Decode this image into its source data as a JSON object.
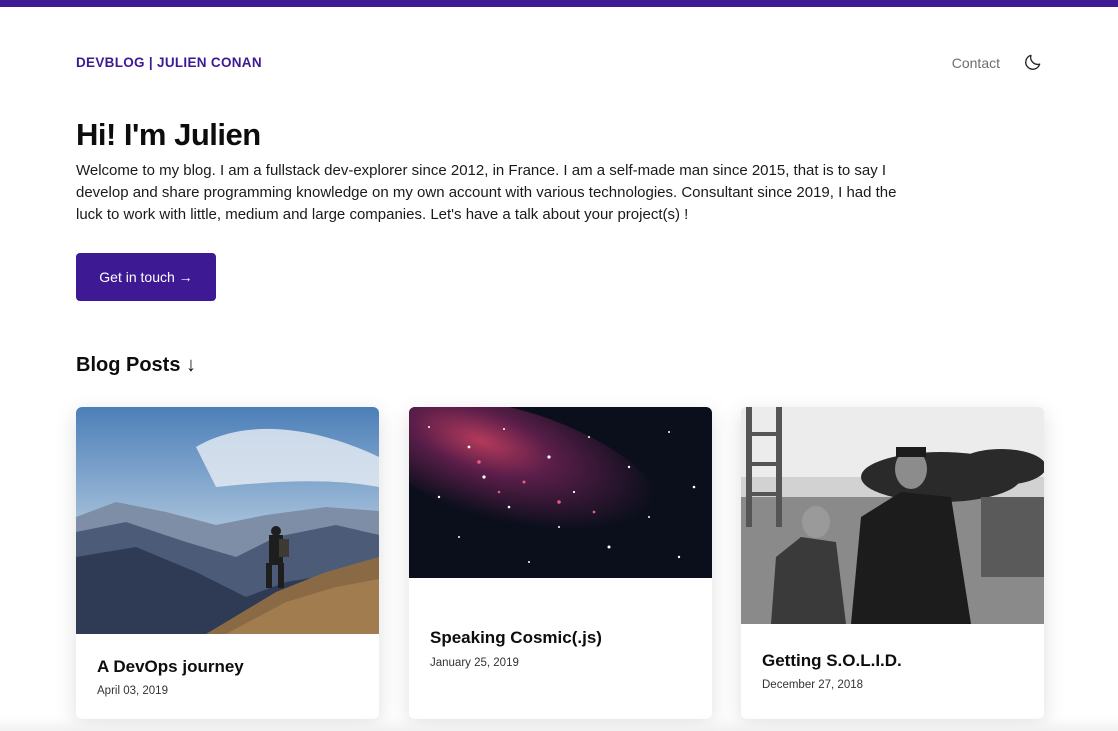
{
  "header": {
    "brand": "DEVBLOG | JULIEN CONAN",
    "nav": {
      "contact": "Contact"
    },
    "theme_icon": "moon-icon"
  },
  "hero": {
    "title": "Hi! I'm Julien",
    "text": "Welcome to my blog. I am a fullstack dev-explorer since 2012, in France. I am a self-made man since 2015, that is to say I develop and share programming knowledge on my own account with various technologies. Consultant since 2019, I had the luck to work with little, medium and large companies. Let's have a talk about your project(s) !",
    "cta": "Get in touch →"
  },
  "blog": {
    "section_title": "Blog Posts ↓",
    "posts": [
      {
        "title": "A DevOps journey",
        "date": "April 03, 2019",
        "image": "mountain-hiker-photo"
      },
      {
        "title": "Speaking Cosmic(.js)",
        "date": "January 25, 2019",
        "image": "galaxy-stars-photo"
      },
      {
        "title": "Getting S.O.L.I.D.",
        "date": "December 27, 2018",
        "image": "samurai-film-photo"
      }
    ]
  },
  "colors": {
    "accent": "#3d1a94",
    "text": "#111111",
    "muted": "#6e6e6e"
  }
}
